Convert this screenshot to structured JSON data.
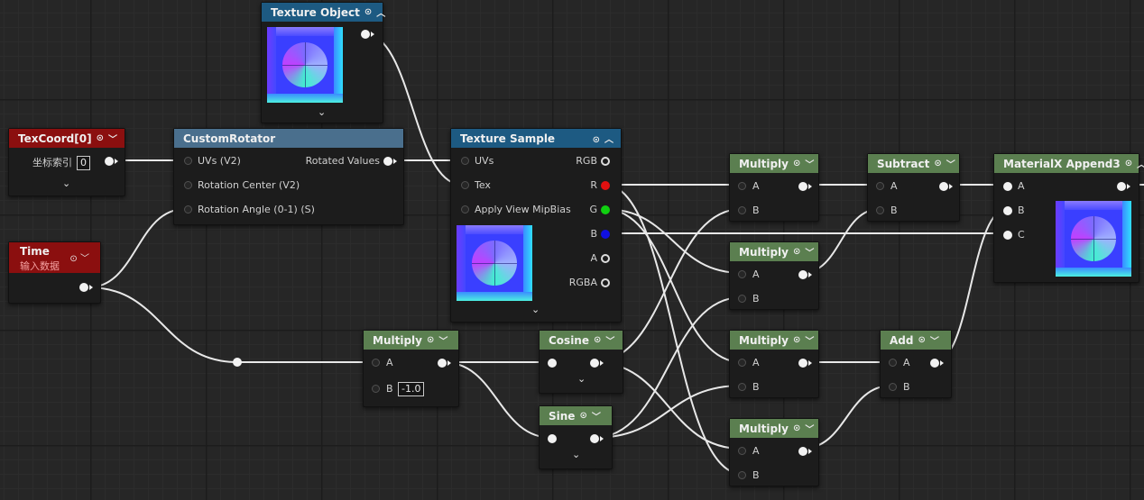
{
  "colors": {
    "material_node": "#5b7f50",
    "texture_node": "#1d5a82",
    "custom_node": "#4a6f8d",
    "input_node": "#8b0f0f",
    "wire": "#e8e8e8"
  },
  "icons": {
    "preview_toggle": "circle-arrow-icon",
    "collapse": "chevron-down-icon",
    "expand": "chevron-up-icon"
  },
  "nodes": {
    "texture_object": {
      "title": "Texture Object"
    },
    "texcoord": {
      "title": "TexCoord[0]",
      "pin_label": "坐标索引",
      "value": "0"
    },
    "custom_rotator": {
      "title": "CustomRotator",
      "in_uvs": "UVs (V2)",
      "in_center": "Rotation Center (V2)",
      "in_angle": "Rotation Angle (0-1) (S)",
      "out": "Rotated Values"
    },
    "texture_sample": {
      "title": "Texture Sample",
      "in_uvs": "UVs",
      "in_tex": "Tex",
      "in_mip": "Apply View MipBias",
      "out_rgb": "RGB",
      "out_r": "R",
      "out_g": "G",
      "out_b": "B",
      "out_a": "A",
      "out_rgba": "RGBA"
    },
    "time": {
      "title": "Time",
      "subtitle": "输入数据"
    },
    "multiply_main": {
      "title": "Multiply",
      "in_a": "A",
      "in_b": "B",
      "value_b": "-1.0"
    },
    "cosine": {
      "title": "Cosine"
    },
    "sine": {
      "title": "Sine"
    },
    "multiply_1": {
      "title": "Multiply",
      "in_a": "A",
      "in_b": "B"
    },
    "multiply_2": {
      "title": "Multiply",
      "in_a": "A",
      "in_b": "B"
    },
    "multiply_3": {
      "title": "Multiply",
      "in_a": "A",
      "in_b": "B"
    },
    "multiply_4": {
      "title": "Multiply",
      "in_a": "A",
      "in_b": "B"
    },
    "subtract": {
      "title": "Subtract",
      "in_a": "A",
      "in_b": "B"
    },
    "add": {
      "title": "Add",
      "in_a": "A",
      "in_b": "B"
    },
    "append3": {
      "title": "MaterialX Append3",
      "in_a": "A",
      "in_b": "B",
      "in_c": "C"
    }
  }
}
